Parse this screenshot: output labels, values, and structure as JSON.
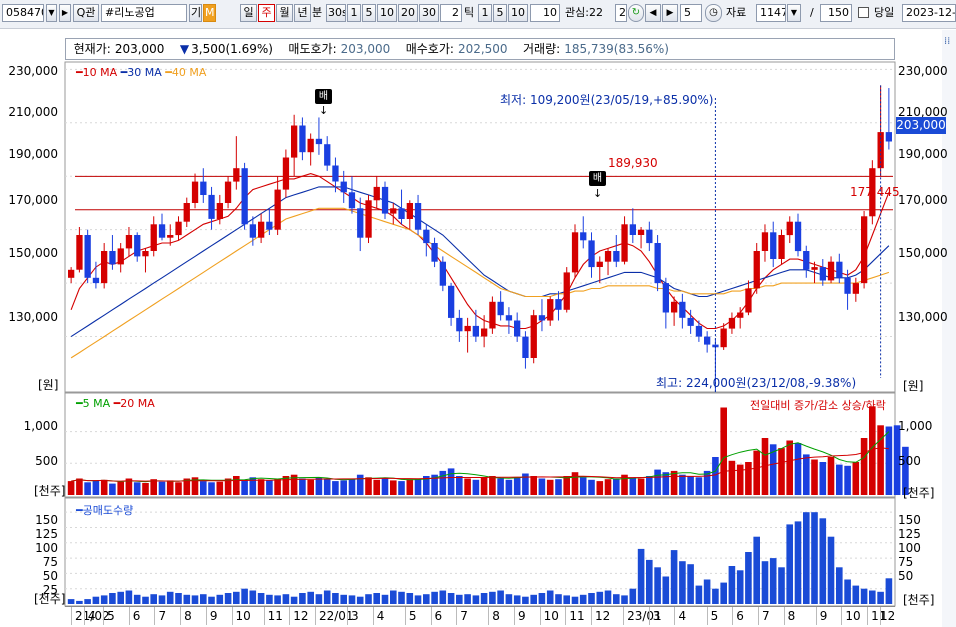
{
  "toolbar": {
    "code": "058470",
    "play_icon": "▶",
    "search_label": "Q",
    "gwan_label": "관",
    "stock_name": "#리노공업",
    "gi_label": "기",
    "m_label": "M",
    "periods": [
      "일",
      "주",
      "월",
      "년"
    ],
    "active_period": "주",
    "bun_label": "분",
    "minute_options": [
      "30s",
      "1",
      "5",
      "10",
      "20",
      "30"
    ],
    "tick_value": "2",
    "tick_label": "틱",
    "tick_options": [
      "1",
      "5",
      "10"
    ],
    "tick_extra": "10",
    "gwansim_label": "관심:22",
    "gwansim_extra": "2",
    "step_value": "5",
    "jaryo_label": "자료",
    "count_value": "1147",
    "slash": "/",
    "total_value": "150",
    "dangil_label": "당일",
    "date_value": "2023-12-"
  },
  "info": {
    "price_label": "현재가:",
    "price_value": "203,000",
    "change_icon": "▼",
    "change_value": "3,500(1.69%)",
    "ask_label": "매도호가:",
    "ask_value": "203,000",
    "bid_label": "매수호가:",
    "bid_value": "202,500",
    "vol_label": "거래량:",
    "vol_value": "185,739(83.56%)"
  },
  "price_axis": {
    "labels": [
      "230,000",
      "210,000",
      "190,000",
      "170,000",
      "150,000",
      "130,000"
    ],
    "values": [
      230000,
      210000,
      190000,
      170000,
      150000,
      130000
    ],
    "unit": "[원]",
    "current_tag": "203,000"
  },
  "volume_axis": {
    "labels": [
      "1,000",
      "500"
    ],
    "values": [
      1000,
      500
    ],
    "unit": "[천주]"
  },
  "short_axis": {
    "labels": [
      "150",
      "125",
      "100",
      "75",
      "50",
      "25"
    ],
    "values": [
      150,
      125,
      100,
      75,
      50,
      25
    ],
    "unit": "[천주]"
  },
  "x_axis": [
    "21/02",
    "4",
    "5",
    "6",
    "7",
    "8",
    "9",
    "10",
    "11",
    "12",
    "22/01",
    "3",
    "4",
    "5",
    "6",
    "7",
    "8",
    "9",
    "10",
    "11",
    "12",
    "23/01",
    "3",
    "4",
    "5",
    "6",
    "7",
    "8",
    "9",
    "10",
    "11",
    "12"
  ],
  "legends": {
    "price": [
      {
        "label": "10 MA",
        "color": "#d40000"
      },
      {
        "label": "30 MA",
        "color": "#0a2fa8"
      },
      {
        "label": "40 MA",
        "color": "#f0a020"
      }
    ],
    "volume": [
      {
        "label": "5 MA",
        "color": "#00a000"
      },
      {
        "label": "20 MA",
        "color": "#d40000"
      }
    ],
    "volume_right": "전일대비 증가/감소 상승/하락",
    "short": {
      "label": "공매도수량",
      "color": "#1a4bd6"
    }
  },
  "annotations": {
    "low_note": "최저: 109,200원(23/05/19,+85.90%)",
    "high_note": "최고: 224,000원(23/12/08,-9.38%)",
    "level_1": "189,930",
    "level_2": "177,445",
    "badge_1": "배",
    "badge_2": "배"
  },
  "colors": {
    "up": "#d40000",
    "down": "#1a3fe0",
    "ma10": "#d40000",
    "ma30": "#0a2fa8",
    "ma40": "#f0a020",
    "grid": "#d8d8d8",
    "hline": "#c00000"
  },
  "chart_data": {
    "type": "candlestick",
    "interval": "weekly",
    "yrange": [
      110000,
      232000
    ],
    "levels": [
      189930,
      177445
    ],
    "candles": [
      [
        152000,
        156000,
        150000,
        155000
      ],
      [
        155000,
        171000,
        154000,
        168000
      ],
      [
        168000,
        170000,
        150000,
        152000
      ],
      [
        152000,
        158000,
        148000,
        150000
      ],
      [
        150000,
        165000,
        148000,
        162000
      ],
      [
        162000,
        168000,
        155000,
        157000
      ],
      [
        157000,
        165000,
        154000,
        163000
      ],
      [
        163000,
        171000,
        160000,
        168000
      ],
      [
        168000,
        169000,
        158000,
        160000
      ],
      [
        160000,
        163000,
        154000,
        162000
      ],
      [
        162000,
        175000,
        160000,
        172000
      ],
      [
        172000,
        176000,
        166000,
        167000
      ],
      [
        167000,
        172000,
        164000,
        168000
      ],
      [
        168000,
        175000,
        166000,
        173000
      ],
      [
        173000,
        182000,
        171000,
        180000
      ],
      [
        180000,
        191000,
        178000,
        188000
      ],
      [
        188000,
        193000,
        180000,
        183000
      ],
      [
        183000,
        186000,
        170000,
        174000
      ],
      [
        174000,
        183000,
        172000,
        180000
      ],
      [
        180000,
        190000,
        178000,
        188000
      ],
      [
        188000,
        205000,
        185000,
        193000
      ],
      [
        193000,
        195000,
        170000,
        172000
      ],
      [
        172000,
        175000,
        164000,
        167000
      ],
      [
        167000,
        176000,
        165000,
        173000
      ],
      [
        173000,
        178000,
        168000,
        170000
      ],
      [
        170000,
        190000,
        168000,
        185000
      ],
      [
        185000,
        200000,
        182000,
        197000
      ],
      [
        197000,
        213000,
        190000,
        209000
      ],
      [
        209000,
        212000,
        196000,
        199000
      ],
      [
        199000,
        206000,
        194000,
        204000
      ],
      [
        204000,
        212000,
        198000,
        202000
      ],
      [
        202000,
        205000,
        192000,
        194000
      ],
      [
        194000,
        197000,
        184000,
        188000
      ],
      [
        188000,
        192000,
        180000,
        184000
      ],
      [
        184000,
        190000,
        176000,
        178000
      ],
      [
        178000,
        182000,
        162000,
        167000
      ],
      [
        167000,
        183000,
        165000,
        181000
      ],
      [
        181000,
        190000,
        178000,
        186000
      ],
      [
        186000,
        188000,
        174000,
        176000
      ],
      [
        176000,
        180000,
        172000,
        178000
      ],
      [
        178000,
        185000,
        172000,
        174000
      ],
      [
        174000,
        181000,
        170000,
        180000
      ],
      [
        180000,
        183000,
        168000,
        170000
      ],
      [
        170000,
        172000,
        160000,
        165000
      ],
      [
        165000,
        167000,
        156000,
        158000
      ],
      [
        158000,
        160000,
        147000,
        149000
      ],
      [
        149000,
        150000,
        134000,
        137000
      ],
      [
        137000,
        140000,
        128000,
        132000
      ],
      [
        132000,
        137000,
        124000,
        134000
      ],
      [
        134000,
        140000,
        128000,
        130000
      ],
      [
        130000,
        138000,
        126000,
        133000
      ],
      [
        133000,
        145000,
        131000,
        143000
      ],
      [
        143000,
        147000,
        136000,
        138000
      ],
      [
        138000,
        141000,
        131000,
        136000
      ],
      [
        136000,
        139000,
        128000,
        130000
      ],
      [
        130000,
        132000,
        118000,
        122000
      ],
      [
        122000,
        140000,
        120000,
        138000
      ],
      [
        138000,
        144000,
        132000,
        136000
      ],
      [
        136000,
        145000,
        134000,
        144000
      ],
      [
        144000,
        147000,
        136000,
        140000
      ],
      [
        140000,
        156000,
        139000,
        154000
      ],
      [
        154000,
        172000,
        152000,
        169000
      ],
      [
        169000,
        175000,
        163000,
        166000
      ],
      [
        166000,
        169000,
        152000,
        156000
      ],
      [
        156000,
        160000,
        150000,
        158000
      ],
      [
        158000,
        163000,
        153000,
        162000
      ],
      [
        162000,
        168000,
        156000,
        158000
      ],
      [
        158000,
        175000,
        157000,
        172000
      ],
      [
        172000,
        178000,
        165000,
        168000
      ],
      [
        168000,
        171000,
        163000,
        170000
      ],
      [
        170000,
        173000,
        162000,
        165000
      ],
      [
        165000,
        168000,
        147000,
        150000
      ],
      [
        150000,
        152000,
        133000,
        139000
      ],
      [
        139000,
        145000,
        134000,
        143000
      ],
      [
        143000,
        146000,
        133000,
        137000
      ],
      [
        137000,
        140000,
        131000,
        134000
      ],
      [
        134000,
        136000,
        128000,
        130000
      ],
      [
        130000,
        132000,
        124000,
        127000
      ],
      [
        127000,
        129000,
        109200,
        126000
      ],
      [
        126000,
        135000,
        125000,
        133000
      ],
      [
        133000,
        139000,
        131000,
        137000
      ],
      [
        137000,
        141000,
        133000,
        139000
      ],
      [
        139000,
        151000,
        138000,
        148000
      ],
      [
        148000,
        165000,
        146000,
        162000
      ],
      [
        162000,
        172000,
        158000,
        169000
      ],
      [
        169000,
        173000,
        156000,
        159000
      ],
      [
        159000,
        170000,
        157000,
        168000
      ],
      [
        168000,
        175000,
        165000,
        173000
      ],
      [
        173000,
        176000,
        160000,
        162000
      ],
      [
        162000,
        164000,
        152000,
        155000
      ],
      [
        155000,
        158000,
        150000,
        156000
      ],
      [
        156000,
        159000,
        149000,
        151000
      ],
      [
        151000,
        160000,
        150000,
        158000
      ],
      [
        158000,
        161000,
        150000,
        152000
      ],
      [
        152000,
        155000,
        140000,
        146000
      ],
      [
        146000,
        152000,
        143000,
        150000
      ],
      [
        150000,
        177000,
        148000,
        175000
      ],
      [
        175000,
        196000,
        172000,
        193000
      ],
      [
        193000,
        224000,
        190000,
        206500
      ],
      [
        206500,
        223000,
        200000,
        203000
      ]
    ],
    "ma": {
      "10 MA": [
        140000,
        148000,
        152000,
        156000,
        158000,
        157000,
        158000,
        160000,
        162000,
        163000,
        164000,
        165000,
        165000,
        166000,
        168000,
        170000,
        172000,
        173000,
        174000,
        175000,
        178000,
        182000,
        185000,
        186000,
        187000,
        188000,
        189000,
        189000,
        190000,
        191000,
        190000,
        188000,
        186000,
        184000,
        182000,
        180000,
        179000,
        178000,
        177000,
        175000,
        172000,
        170000,
        168000,
        165000,
        161000,
        157000,
        152000,
        147000,
        142000,
        138000,
        136000,
        135000,
        134000,
        134000,
        133000,
        133000,
        134000,
        136000,
        138000,
        142000,
        146000,
        152000,
        157000,
        160000,
        162000,
        163000,
        164000,
        165000,
        164000,
        162000,
        158000,
        153000,
        148000,
        144000,
        141000,
        138000,
        135000,
        133000,
        133000,
        134000,
        136000,
        139000,
        143000,
        148000,
        152000,
        155000,
        157000,
        159000,
        159000,
        158000,
        157000,
        156000,
        155000,
        154000,
        153000,
        155000,
        160000,
        168000,
        176000,
        184000
      ],
      "30 MA": [
        130000,
        132000,
        134000,
        136000,
        138000,
        140000,
        142000,
        144000,
        146000,
        148000,
        150000,
        152000,
        154000,
        156000,
        158000,
        160000,
        162000,
        164000,
        166000,
        168000,
        170000,
        172000,
        174000,
        176000,
        178000,
        180000,
        182000,
        183000,
        184000,
        185000,
        186000,
        186000,
        186000,
        186000,
        185000,
        184000,
        183000,
        182000,
        181000,
        180000,
        178000,
        176000,
        174000,
        172000,
        170000,
        168000,
        165000,
        162000,
        159000,
        156000,
        153000,
        151000,
        149000,
        147000,
        146000,
        145000,
        145000,
        145000,
        146000,
        146000,
        147000,
        148000,
        149000,
        150000,
        151000,
        152000,
        153000,
        154000,
        154000,
        154000,
        153000,
        152000,
        150000,
        148000,
        147000,
        146000,
        145000,
        145000,
        146000,
        147000,
        148000,
        149000,
        150000,
        151000,
        152000,
        153000,
        154000,
        155000,
        155000,
        155000,
        154000,
        153000,
        152000,
        152000,
        152000,
        153000,
        155000,
        158000,
        161000,
        164000
      ],
      "40 MA": [
        122000,
        124000,
        126000,
        128000,
        130000,
        132000,
        134000,
        136000,
        138000,
        140000,
        142000,
        144000,
        146000,
        148000,
        150000,
        152000,
        154000,
        156000,
        158000,
        160000,
        162000,
        164000,
        166000,
        168000,
        170000,
        172000,
        174000,
        175000,
        176000,
        177000,
        178000,
        178000,
        178000,
        178000,
        177000,
        176000,
        175000,
        174000,
        173000,
        172000,
        171000,
        170000,
        168000,
        166000,
        164000,
        162000,
        160000,
        158000,
        156000,
        154000,
        152000,
        150000,
        148000,
        147000,
        146000,
        145000,
        145000,
        145000,
        145000,
        146000,
        146000,
        147000,
        147000,
        148000,
        148000,
        149000,
        149000,
        149000,
        149000,
        149000,
        149000,
        148000,
        148000,
        147000,
        147000,
        146000,
        146000,
        146000,
        146000,
        146000,
        147000,
        147000,
        148000,
        148000,
        149000,
        149000,
        150000,
        150000,
        150000,
        150000,
        150000,
        150000,
        150000,
        150000,
        150000,
        150000,
        151000,
        152000,
        153000,
        154000
      ]
    },
    "volume": [
      220,
      260,
      200,
      230,
      240,
      180,
      210,
      260,
      200,
      190,
      250,
      210,
      230,
      200,
      260,
      280,
      220,
      200,
      210,
      260,
      300,
      240,
      280,
      250,
      230,
      260,
      300,
      320,
      260,
      240,
      270,
      250,
      220,
      230,
      260,
      320,
      280,
      240,
      260,
      230,
      220,
      250,
      260,
      300,
      320,
      380,
      420,
      300,
      260,
      240,
      280,
      300,
      260,
      240,
      280,
      340,
      300,
      260,
      240,
      250,
      300,
      360,
      280,
      240,
      220,
      250,
      260,
      320,
      280,
      260,
      300,
      400,
      360,
      380,
      320,
      300,
      280,
      380,
      600,
      1380,
      540,
      480,
      520,
      700,
      900,
      800,
      740,
      860,
      820,
      640,
      560,
      520,
      600,
      480,
      460,
      520,
      900,
      1400,
      1100,
      1080,
      1100,
      760
    ],
    "short": [
      8,
      5,
      8,
      12,
      14,
      18,
      20,
      22,
      15,
      12,
      16,
      14,
      20,
      18,
      15,
      14,
      16,
      12,
      15,
      18,
      20,
      25,
      22,
      18,
      15,
      14,
      16,
      12,
      18,
      20,
      16,
      22,
      18,
      15,
      14,
      12,
      16,
      18,
      15,
      22,
      20,
      18,
      14,
      16,
      20,
      22,
      18,
      15,
      16,
      14,
      18,
      20,
      22,
      16,
      14,
      12,
      15,
      18,
      22,
      16,
      14,
      12,
      15,
      18,
      20,
      22,
      16,
      14,
      25,
      90,
      72,
      60,
      45,
      88,
      70,
      65,
      30,
      40,
      25,
      35,
      62,
      55,
      85,
      110,
      70,
      75,
      60,
      130,
      135,
      150,
      150,
      140,
      110,
      60,
      40,
      30,
      25,
      22,
      20,
      42,
      30,
      20,
      12
    ]
  }
}
